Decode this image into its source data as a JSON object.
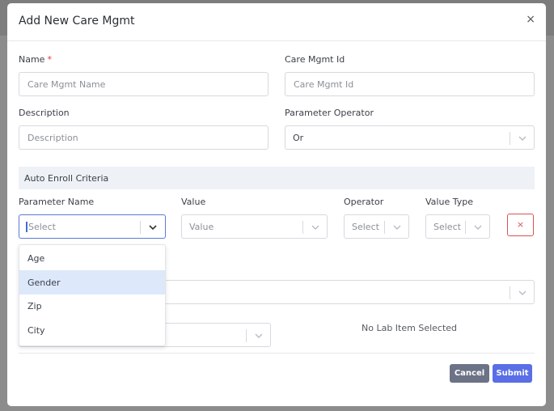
{
  "modal": {
    "title": "Add New Care Mgmt",
    "close": "×"
  },
  "form": {
    "name_label": "Name",
    "required_mark": "*",
    "name_placeholder": "Care Mgmt Name",
    "id_label": "Care Mgmt Id",
    "id_placeholder": "Care Mgmt Id",
    "description_label": "Description",
    "description_placeholder": "Description",
    "operator_label": "Parameter Operator",
    "operator_value": "Or"
  },
  "criteria": {
    "section_title": "Auto Enroll Criteria",
    "col_param": "Parameter Name",
    "col_value": "Value",
    "col_operator": "Operator",
    "col_value_type": "Value Type",
    "param_placeholder": "Select",
    "value_placeholder": "Value",
    "operator_placeholder": "Select",
    "value_type_placeholder": "Select",
    "remove_label": "×"
  },
  "dropdown": {
    "options": [
      "Age",
      "Gender",
      "Zip",
      "City"
    ],
    "highlighted": "Gender"
  },
  "lab": {
    "empty_text": "No Lab Item Selected"
  },
  "footer": {
    "cancel": "Cancel",
    "submit": "Submit"
  }
}
